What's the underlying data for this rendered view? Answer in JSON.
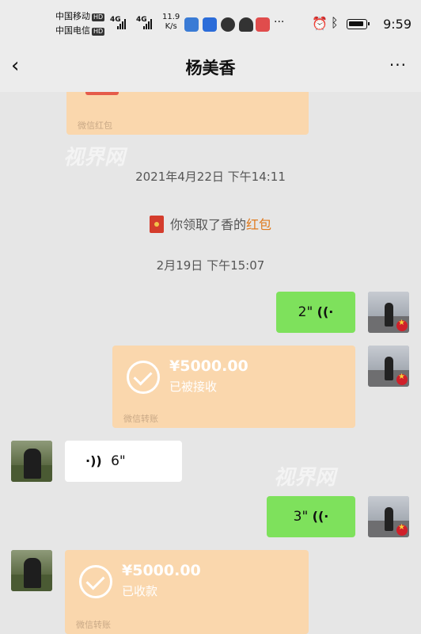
{
  "status_bar": {
    "carrier1": "中国移动",
    "carrier2": "中国电信",
    "hd_badge": "HD",
    "network": "4G",
    "speed_value": "11.9",
    "speed_unit": "K/s",
    "overflow": "···",
    "time": "9:59",
    "icons": [
      "alarm-icon",
      "bluetooth-icon",
      "battery-icon"
    ]
  },
  "header": {
    "title": "杨美香",
    "back_icon": "‹",
    "more_icon": "···"
  },
  "chat": {
    "top_redpacket": {
      "footer": "微信红包"
    },
    "timestamp1": "2021年4月22日 下午14:11",
    "system_message": {
      "prefix": "你领取了香的",
      "highlight": "红包"
    },
    "timestamp2": "2月19日 下午15:07",
    "messages": [
      {
        "type": "voice",
        "side": "right",
        "duration": "2\""
      },
      {
        "type": "transfer",
        "side": "right",
        "amount": "¥5000.00",
        "status": "已被接收",
        "footer": "微信转账"
      },
      {
        "type": "voice",
        "side": "left",
        "duration": "6\""
      },
      {
        "type": "voice",
        "side": "right",
        "duration": "3\""
      },
      {
        "type": "transfer",
        "side": "left",
        "amount": "¥5000.00",
        "status": "已收款",
        "footer": "微信转账"
      }
    ],
    "watermark": "视界网"
  },
  "colors": {
    "green_bubble": "#7ee15c",
    "transfer_bubble": "#fad7ad",
    "background": "#e6e6e6",
    "highlight": "#e07a1e"
  }
}
